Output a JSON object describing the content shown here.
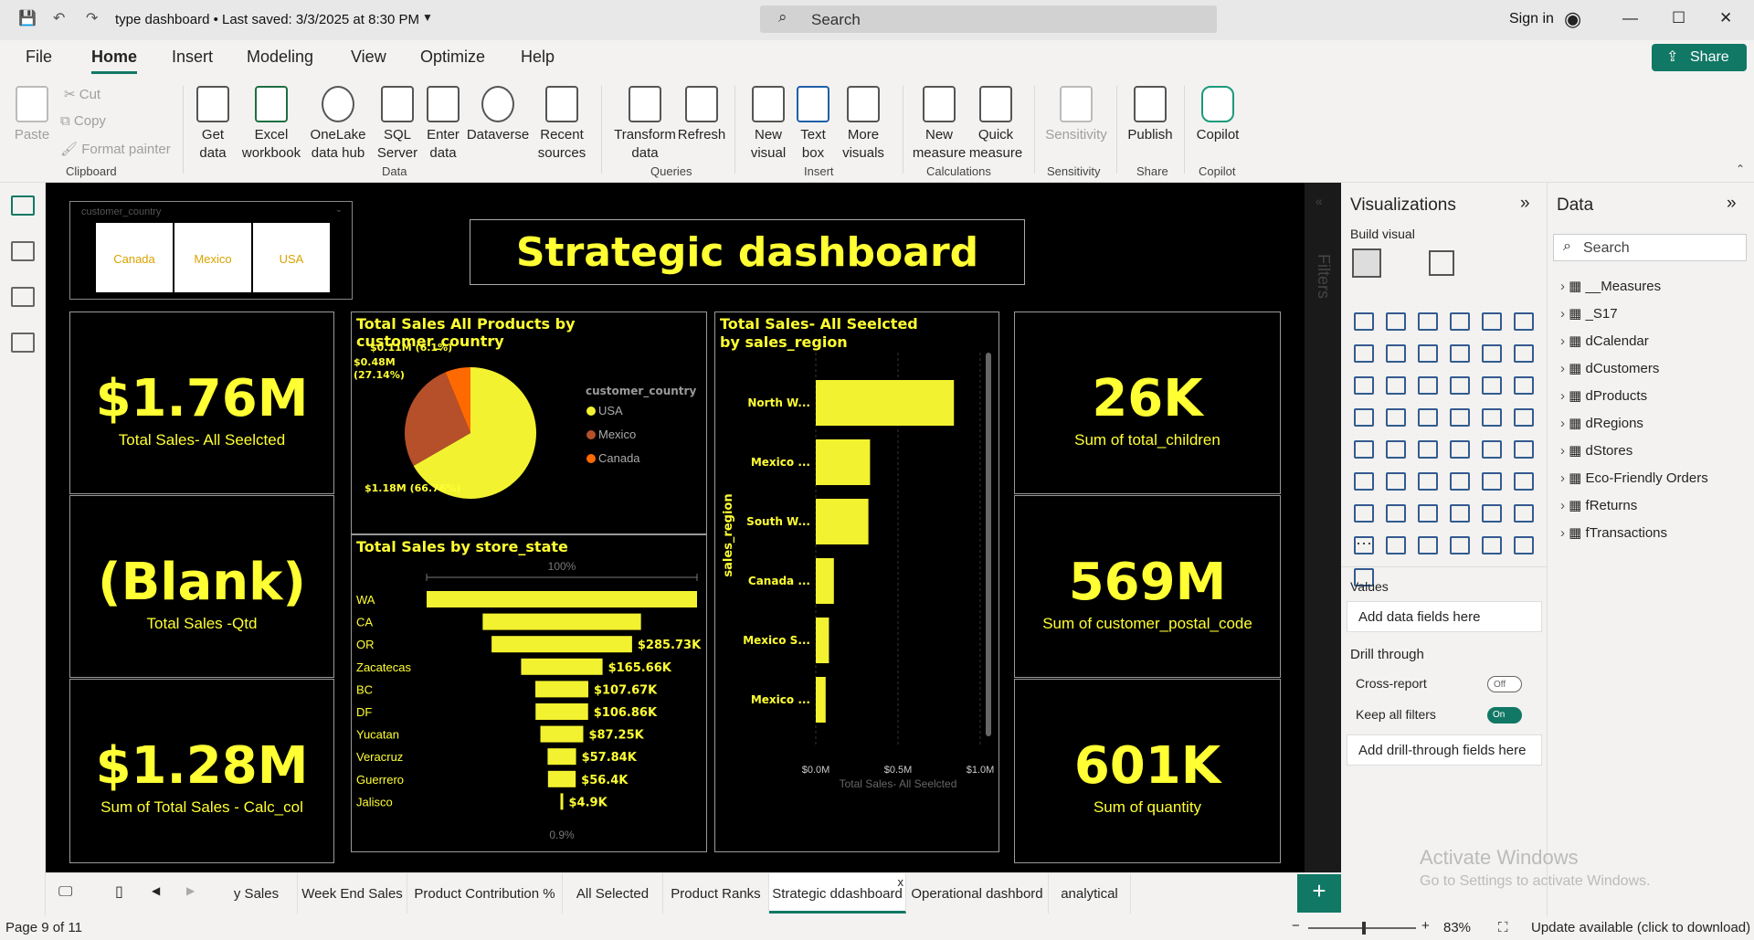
{
  "titlebar": {
    "title": "type dashboard • Last saved: 3/3/2025 at 8:30 PM",
    "search_placeholder": "Search",
    "signin": "Sign in"
  },
  "menu": {
    "tabs": [
      "File",
      "Home",
      "Insert",
      "Modeling",
      "View",
      "Optimize",
      "Help"
    ],
    "active": "Home",
    "share": "Share"
  },
  "ribbon": {
    "clipboard": {
      "paste": "Paste",
      "cut": "Cut",
      "copy": "Copy",
      "format_painter": "Format painter",
      "group": "Clipboard"
    },
    "data": {
      "items": [
        "Get data",
        "Excel workbook",
        "OneLake data hub",
        "SQL Server",
        "Enter data",
        "Dataverse",
        "Recent sources"
      ],
      "group": "Data"
    },
    "queries": {
      "items": [
        "Transform data",
        "Refresh"
      ],
      "group": "Queries"
    },
    "insert": {
      "items": [
        "New visual",
        "Text box",
        "More visuals"
      ],
      "group": "Insert"
    },
    "calculations": {
      "items": [
        "New measure",
        "Quick measure"
      ],
      "group": "Calculations"
    },
    "sensitivity": {
      "items": [
        "Sensitivity"
      ],
      "group": "Sensitivity"
    },
    "share": {
      "items": [
        "Publish"
      ],
      "group": "Share"
    },
    "copilot": {
      "items": [
        "Copilot"
      ],
      "group": "Copilot"
    }
  },
  "report": {
    "title": "Strategic dashboard",
    "slicer": {
      "field": "customer_country",
      "options": [
        "Canada",
        "Mexico",
        "USA"
      ]
    },
    "kpis_left": [
      {
        "value": "$1.76M",
        "label": "Total Sales- All Seelcted"
      },
      {
        "value": "(Blank)",
        "label": "Total Sales -Qtd"
      },
      {
        "value": "$1.28M",
        "label": "Sum of Total Sales - Calc_col"
      }
    ],
    "kpis_right": [
      {
        "value": "26K",
        "label": "Sum of total_children"
      },
      {
        "value": "569M",
        "label": "Sum of customer_postal_code"
      },
      {
        "value": "601K",
        "label": "Sum of quantity"
      }
    ],
    "pie": {
      "title": "Total Sales All Products by customer_country",
      "legend_title": "customer_country",
      "labels": [
        "$1.18M (66.76%)",
        "$0.48M (27.14%)",
        "$0.11M (6.1%)"
      ]
    },
    "funnel": {
      "title": "Total Sales by store_state",
      "top_pct": "100%",
      "bottom_pct": "0.9%"
    },
    "bar": {
      "title": "Total Sales- All Seelcted by sales_region",
      "axis_title": "sales_region",
      "x_title": "Total Sales- All Seelcted"
    }
  },
  "chart_data": [
    {
      "type": "pie",
      "title": "Total Sales All Products by customer_country",
      "categories": [
        "USA",
        "Mexico",
        "Canada"
      ],
      "values": [
        1.18,
        0.48,
        0.11
      ],
      "percents": [
        66.76,
        27.14,
        6.1
      ],
      "colors": [
        "#f2f230",
        "#b5502a",
        "#ff6a00"
      ],
      "legend_title": "customer_country",
      "legend_position": "right"
    },
    {
      "type": "bar",
      "subtype": "funnel",
      "title": "Total Sales by store_state",
      "categories": [
        "WA",
        "CA",
        "OR",
        "Zacatecas",
        "BC",
        "DF",
        "Yucatan",
        "Veracruz",
        "Guerrero",
        "Jalisco"
      ],
      "values": [
        550,
        322,
        285.73,
        165.66,
        107.67,
        106.86,
        87.25,
        57.84,
        56.4,
        4.9
      ],
      "labels": [
        "",
        "",
        "$285.73K",
        "$165.66K",
        "$107.67K",
        "$106.86K",
        "$87.25K",
        "$57.84K",
        "$56.4K",
        "$4.9K"
      ],
      "color": "#f2f230"
    },
    {
      "type": "bar",
      "orientation": "horizontal",
      "title": "Total Sales- All Seelcted by sales_region",
      "categories": [
        "North W...",
        "Mexico ...",
        "South W...",
        "Canada ...",
        "Mexico S...",
        "Mexico ..."
      ],
      "values": [
        0.84,
        0.33,
        0.32,
        0.11,
        0.08,
        0.06
      ],
      "xticks": [
        "$0.0M",
        "$0.5M",
        "$1.0M"
      ],
      "xlim": [
        0,
        1.0
      ],
      "xlabel": "Total Sales- All Seelcted",
      "ylabel": "sales_region",
      "color": "#f2f230"
    }
  ],
  "vizpane": {
    "title": "Visualizations",
    "build": "Build visual",
    "values": "Values",
    "add_data": "Add data fields here",
    "drill": "Drill through",
    "cross_report": "Cross-report",
    "cross_state": "Off",
    "keep_filters": "Keep all filters",
    "keep_state": "On",
    "add_drill": "Add drill-through fields here",
    "filters": "Filters"
  },
  "datapane": {
    "title": "Data",
    "search": "Search",
    "tables": [
      "__Measures",
      "_S17",
      "dCalendar",
      "dCustomers",
      "dProducts",
      "dRegions",
      "dStores",
      "Eco-Friendly Orders",
      "fReturns",
      "fTransactions"
    ]
  },
  "pages": {
    "tabs": [
      "y Sales",
      "Week End Sales",
      "Product Contribution %",
      "All Selected",
      "Product Ranks",
      "Strategic ddashboard",
      "Operational dashbord",
      "analytical"
    ],
    "active": "Strategic ddashboard",
    "close": "x"
  },
  "status": {
    "page": "Page 9 of 11",
    "zoom": "83%",
    "update": "Update available (click to download)"
  },
  "watermark": {
    "line1": "Activate Windows",
    "line2": "Go to Settings to activate Windows."
  }
}
